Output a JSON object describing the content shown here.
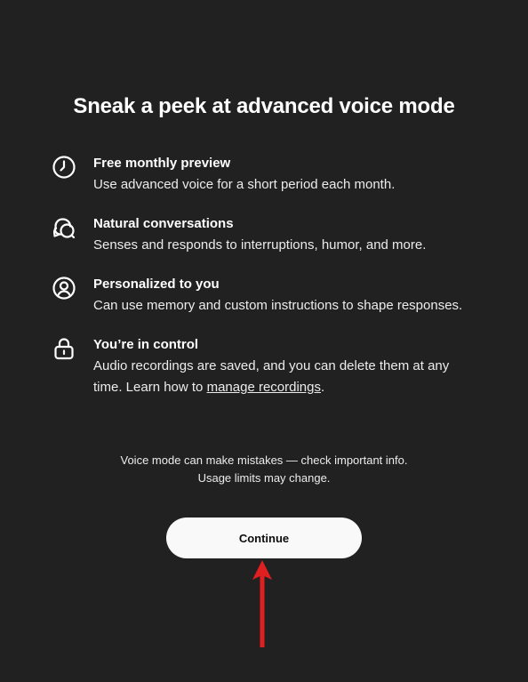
{
  "title": "Sneak a peek at advanced voice mode",
  "features": [
    {
      "icon": "clock-icon",
      "title": "Free monthly preview",
      "description": "Use advanced voice for a short period each month."
    },
    {
      "icon": "chat-bubbles-icon",
      "title": "Natural conversations",
      "description": "Senses and responds to interruptions, humor, and more."
    },
    {
      "icon": "user-circle-icon",
      "title": "Personalized to you",
      "description": "Can use memory and custom instructions to shape responses."
    },
    {
      "icon": "lock-icon",
      "title": "You’re in control",
      "description_before": "Audio recordings are saved, and you can delete them at any time. Learn how to ",
      "link_text": "manage recordings",
      "description_after": "."
    }
  ],
  "disclaimer": {
    "line1": "Voice mode can make mistakes — check important info.",
    "line2": "Usage limits may change."
  },
  "continue_label": "Continue",
  "colors": {
    "background": "#212121",
    "button": "#f9f9f9",
    "arrow": "#e02020"
  }
}
